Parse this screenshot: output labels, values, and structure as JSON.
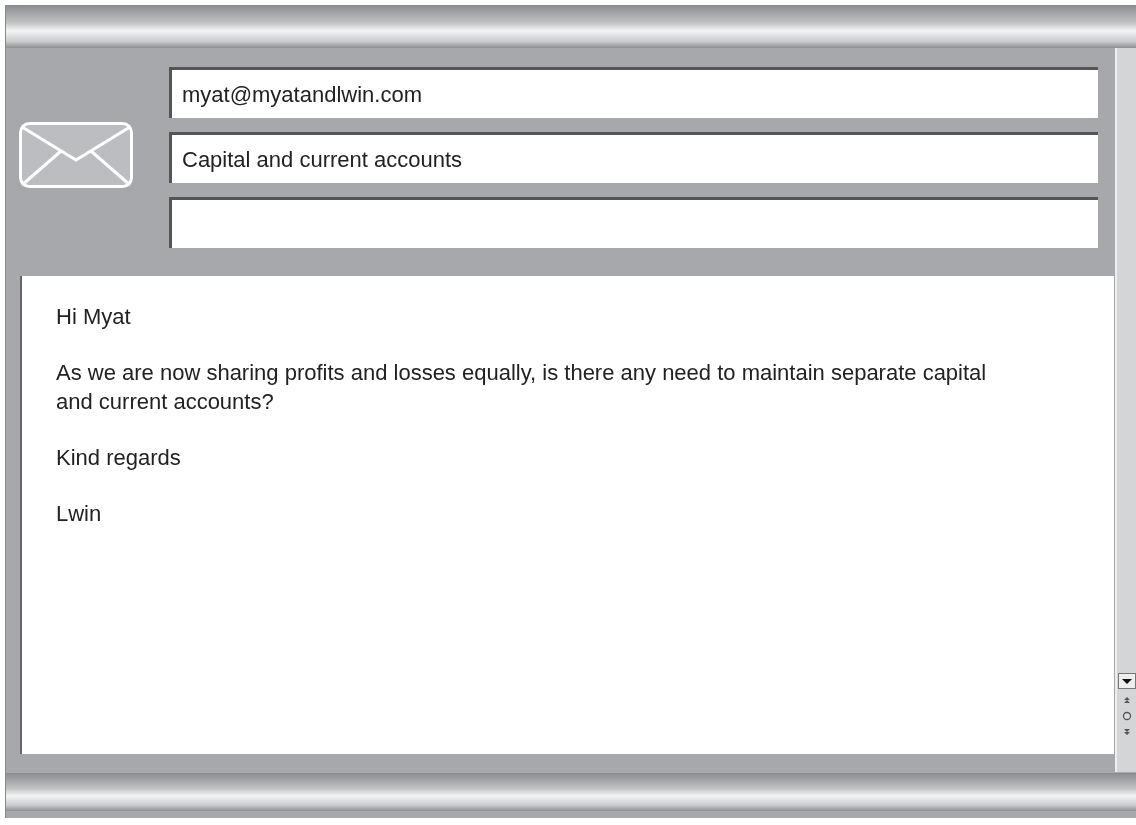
{
  "header_fields": [
    {
      "kind": "text",
      "value": "myat@myatandlwin.com"
    },
    {
      "kind": "text",
      "value": "Capital and current accounts"
    },
    {
      "kind": "empty"
    }
  ],
  "message": {
    "paragraphs": [
      "Hi Myat",
      "As we are now sharing profits and losses equally, is there any need to maintain separate capital and current accounts?",
      "Kind regards",
      "Lwin"
    ]
  }
}
